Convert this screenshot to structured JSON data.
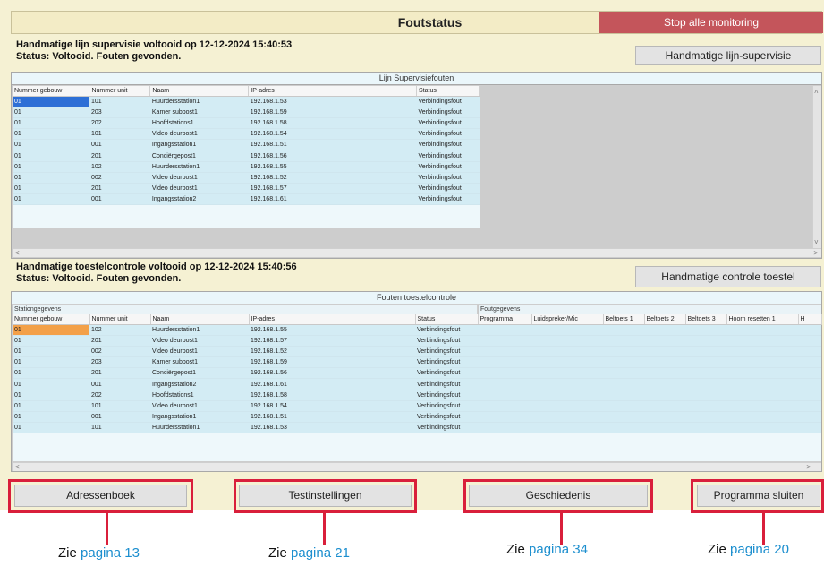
{
  "header": {
    "title": "Foutstatus",
    "stop_button": "Stop alle monitoring"
  },
  "line_section": {
    "status_line1": "Handmatige lijn supervisie voltooid op 12-12-2024 15:40:53",
    "status_line2": "Status: Voltooid. Fouten gevonden.",
    "button": "Handmatige lijn-supervisie",
    "panel_title": "Lijn Supervisiefouten",
    "columns": [
      "Nummer gebouw",
      "Nummer unit",
      "Naam",
      "IP-adres",
      "Status"
    ],
    "rows": [
      [
        "01",
        "101",
        "Huurdersstation1",
        "192.168.1.53",
        "Verbindingsfout"
      ],
      [
        "01",
        "203",
        "Kamer subpost1",
        "192.168.1.59",
        "Verbindingsfout"
      ],
      [
        "01",
        "202",
        "Hoofdstations1",
        "192.168.1.58",
        "Verbindingsfout"
      ],
      [
        "01",
        "101",
        "Video deurpost1",
        "192.168.1.54",
        "Verbindingsfout"
      ],
      [
        "01",
        "001",
        "Ingangsstation1",
        "192.168.1.51",
        "Verbindingsfout"
      ],
      [
        "01",
        "201",
        "Conciërgepost1",
        "192.168.1.56",
        "Verbindingsfout"
      ],
      [
        "01",
        "102",
        "Huurdersstation1",
        "192.168.1.55",
        "Verbindingsfout"
      ],
      [
        "01",
        "002",
        "Video deurpost1",
        "192.168.1.52",
        "Verbindingsfout"
      ],
      [
        "01",
        "201",
        "Video deurpost1",
        "192.168.1.57",
        "Verbindingsfout"
      ],
      [
        "01",
        "001",
        "Ingangsstation2",
        "192.168.1.61",
        "Verbindingsfout"
      ]
    ]
  },
  "device_section": {
    "status_line1": "Handmatige toestelcontrole voltooid op 12-12-2024 15:40:56",
    "status_line2": "Status: Voltooid. Fouten gevonden.",
    "button": "Handmatige controle toestel",
    "panel_title": "Fouten toestelcontrole",
    "group_station": "Stationgegevens",
    "group_fault": "Foutgegevens",
    "columns": [
      "Nummer gebouw",
      "Nummer unit",
      "Naam",
      "IP-adres",
      "Status"
    ],
    "fault_columns": [
      "Programma",
      "Luidspreker/Mic",
      "Beltoets 1",
      "Beltoets 2",
      "Beltoets 3",
      "Hoorn resetten 1",
      "H"
    ],
    "rows": [
      [
        "01",
        "102",
        "Huurdersstation1",
        "192.168.1.55",
        "Verbindingsfout"
      ],
      [
        "01",
        "201",
        "Video deurpost1",
        "192.168.1.57",
        "Verbindingsfout"
      ],
      [
        "01",
        "002",
        "Video deurpost1",
        "192.168.1.52",
        "Verbindingsfout"
      ],
      [
        "01",
        "203",
        "Kamer subpost1",
        "192.168.1.59",
        "Verbindingsfout"
      ],
      [
        "01",
        "201",
        "Conciërgepost1",
        "192.168.1.56",
        "Verbindingsfout"
      ],
      [
        "01",
        "001",
        "Ingangsstation2",
        "192.168.1.61",
        "Verbindingsfout"
      ],
      [
        "01",
        "202",
        "Hoofdstations1",
        "192.168.1.58",
        "Verbindingsfout"
      ],
      [
        "01",
        "101",
        "Video deurpost1",
        "192.168.1.54",
        "Verbindingsfout"
      ],
      [
        "01",
        "001",
        "Ingangsstation1",
        "192.168.1.51",
        "Verbindingsfout"
      ],
      [
        "01",
        "101",
        "Huurdersstation1",
        "192.168.1.53",
        "Verbindingsfout"
      ]
    ]
  },
  "bottom_buttons": {
    "address_book": "Adressenboek",
    "test_settings": "Testinstellingen",
    "history": "Geschiedenis",
    "close_program": "Programma sluiten"
  },
  "captions": {
    "prefix": "Zie",
    "address_book_page": "pagina 13",
    "test_settings_page": "pagina 21",
    "history_page": "pagina 34",
    "close_program_page": "pagina 20"
  },
  "scroll_glyphs": {
    "up": "˄",
    "down": "˅",
    "left": "<",
    "right": ">"
  },
  "colors": {
    "stop_button": "#c4555b",
    "annotation": "#d91f3b",
    "link": "#1d8fcf",
    "selected_blue": "#2d6fd6",
    "selected_orange": "#f3a048"
  }
}
